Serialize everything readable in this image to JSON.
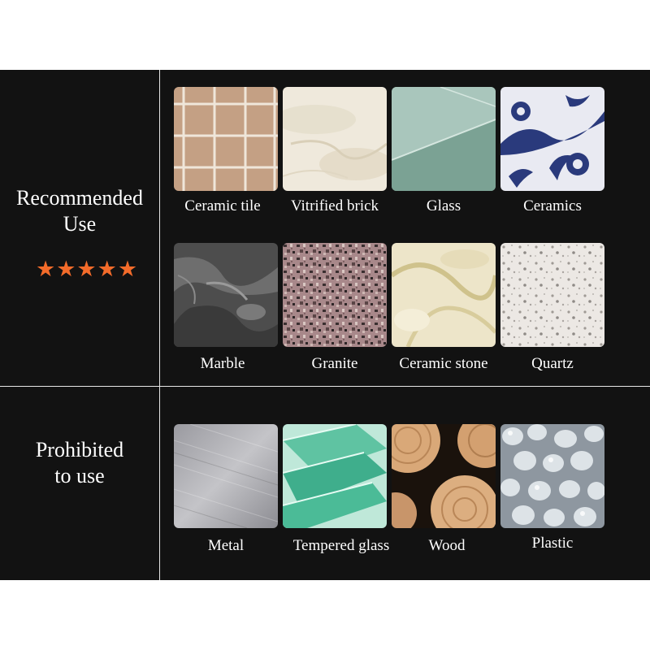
{
  "recommended": {
    "label_line1": "Recommended",
    "label_line2": "Use",
    "rating": "★★★★★",
    "rating_color": "#f36b2a",
    "items": [
      {
        "label": "Ceramic tile",
        "icon": "ceramic-tile-swatch"
      },
      {
        "label": "Vitrified brick",
        "icon": "vitrified-brick-swatch"
      },
      {
        "label": "Glass",
        "icon": "glass-swatch"
      },
      {
        "label": "Ceramics",
        "icon": "ceramics-swatch"
      },
      {
        "label": "Marble",
        "icon": "marble-swatch"
      },
      {
        "label": "Granite",
        "icon": "granite-swatch"
      },
      {
        "label": "Ceramic stone",
        "icon": "ceramic-stone-swatch"
      },
      {
        "label": "Quartz",
        "icon": "quartz-swatch"
      }
    ]
  },
  "prohibited": {
    "label_line1": "Prohibited",
    "label_line2": "to use",
    "items": [
      {
        "label": "Metal",
        "icon": "metal-swatch"
      },
      {
        "label": "Tempered glass",
        "icon": "tempered-glass-swatch"
      },
      {
        "label": "Wood",
        "icon": "wood-swatch"
      },
      {
        "label": "Plastic",
        "icon": "plastic-swatch"
      }
    ]
  },
  "colors": {
    "panel_background": "#121212",
    "divider": "#e6e6e6",
    "text": "#ffffff"
  }
}
